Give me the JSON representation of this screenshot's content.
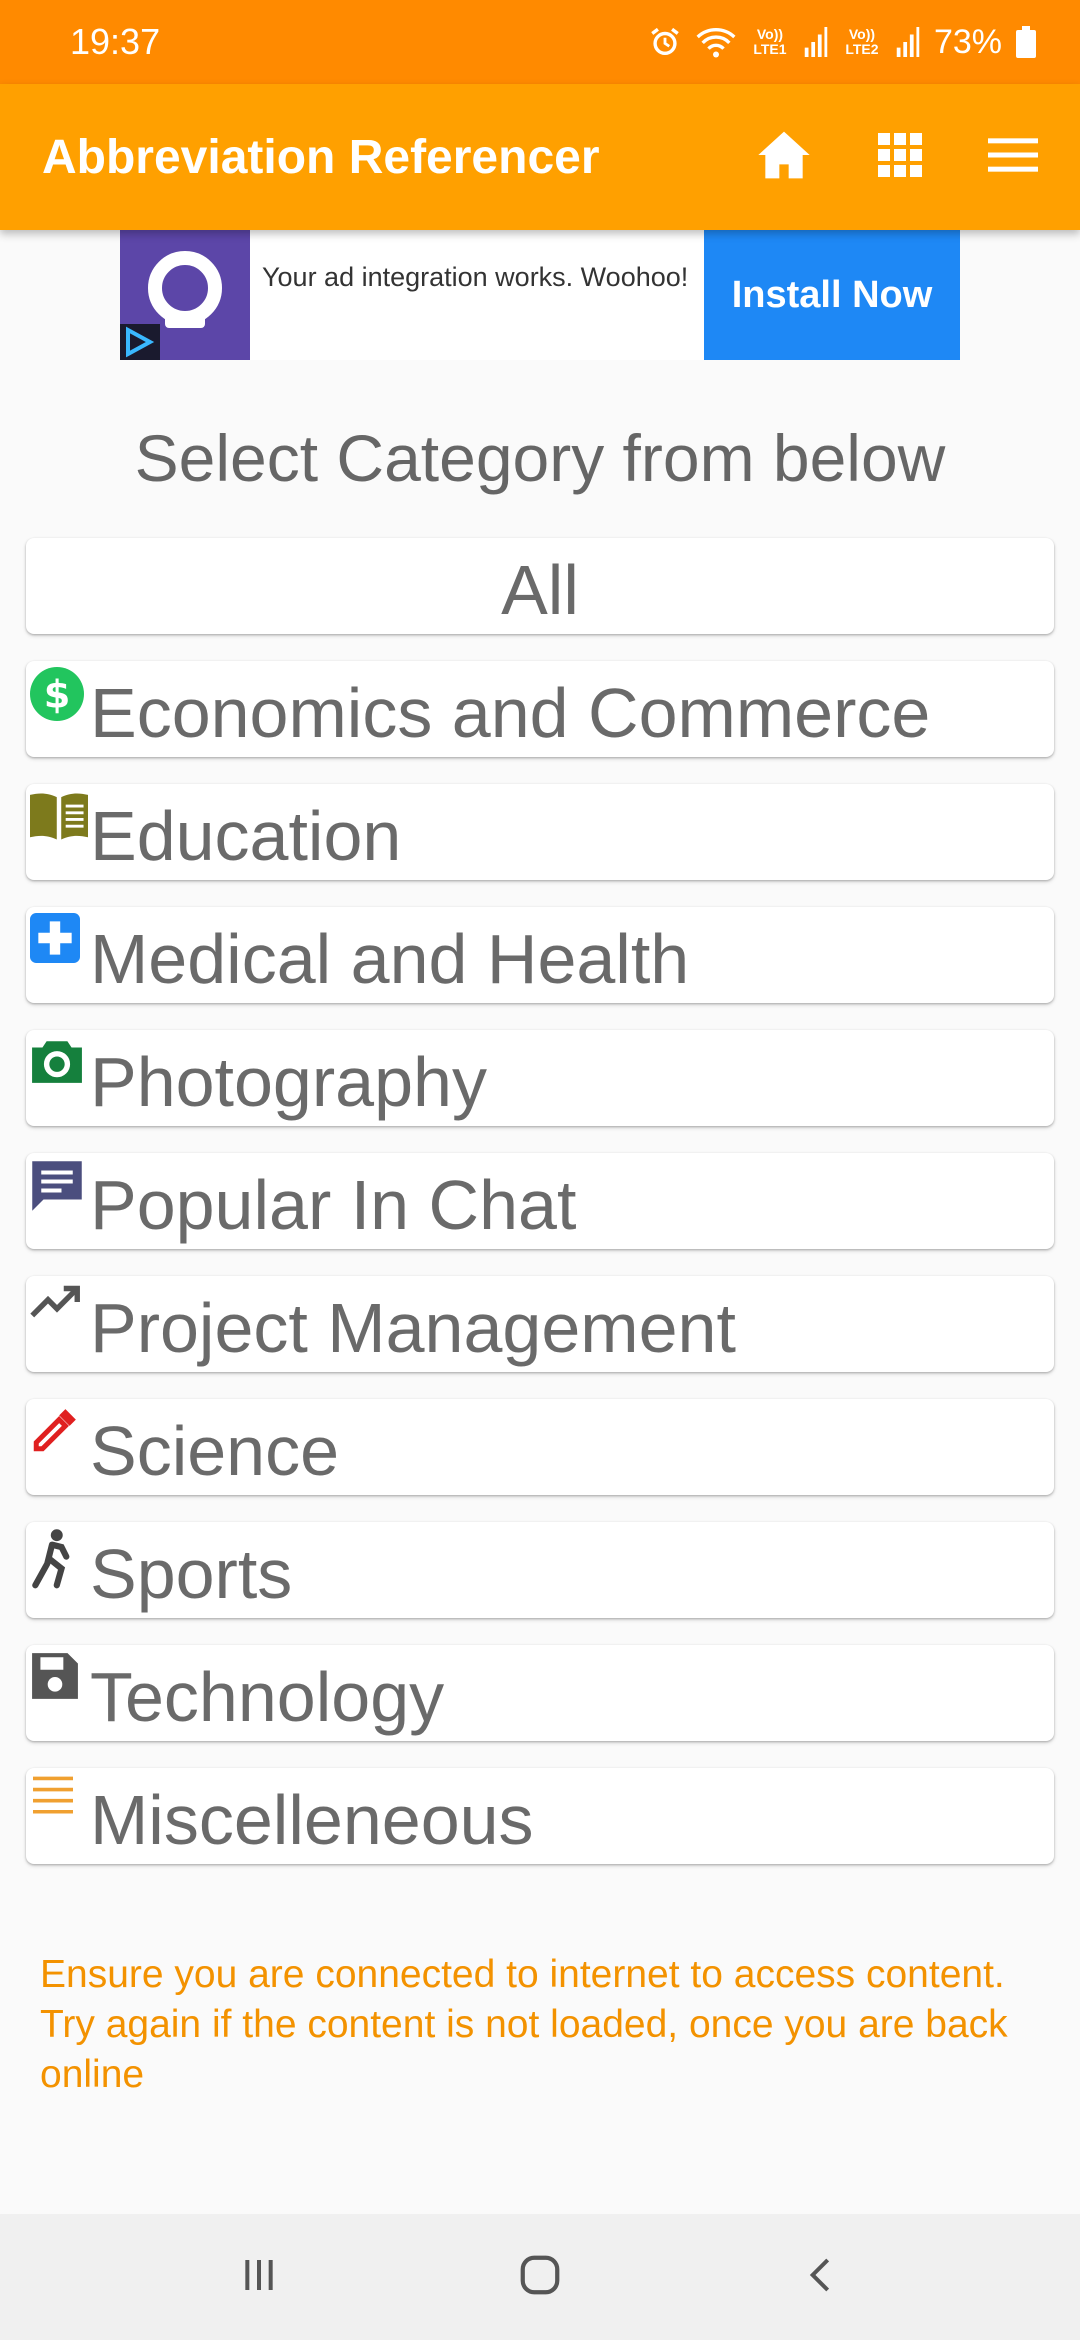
{
  "status": {
    "time": "19:37",
    "battery": "73%",
    "sim1": "Vo)) LTE1",
    "sim2": "Vo)) LTE2"
  },
  "app_bar": {
    "title": "Abbreviation Referencer"
  },
  "ad": {
    "text": "Your ad integration works. Woohoo!",
    "button": "Install Now"
  },
  "heading": "Select Category from below",
  "categories": [
    {
      "label": "All",
      "icon": ""
    },
    {
      "label": "Economics and Commerce",
      "icon": "dollar-icon",
      "color": "#22c55e"
    },
    {
      "label": "Education",
      "icon": "book-icon",
      "color": "#7d7a1c"
    },
    {
      "label": "Medical and Health",
      "icon": "medical-cross-icon",
      "color": "#1e88f5"
    },
    {
      "label": "Photography",
      "icon": "camera-icon",
      "color": "#15803d"
    },
    {
      "label": "Popular In Chat",
      "icon": "chat-icon",
      "color": "#4b4e7e"
    },
    {
      "label": "Project Management",
      "icon": "trending-up-icon",
      "color": "#555555"
    },
    {
      "label": "Science",
      "icon": "dropper-icon",
      "color": "#e02020"
    },
    {
      "label": "Sports",
      "icon": "athlete-icon",
      "color": "#444444"
    },
    {
      "label": "Technology",
      "icon": "floppy-disk-icon",
      "color": "#555555"
    },
    {
      "label": "Miscelleneous",
      "icon": "lines-icon",
      "color": "#f0a030"
    }
  ],
  "notice": "Ensure you are connected to internet to access content. Try again if the content is not loaded, once you are back online"
}
